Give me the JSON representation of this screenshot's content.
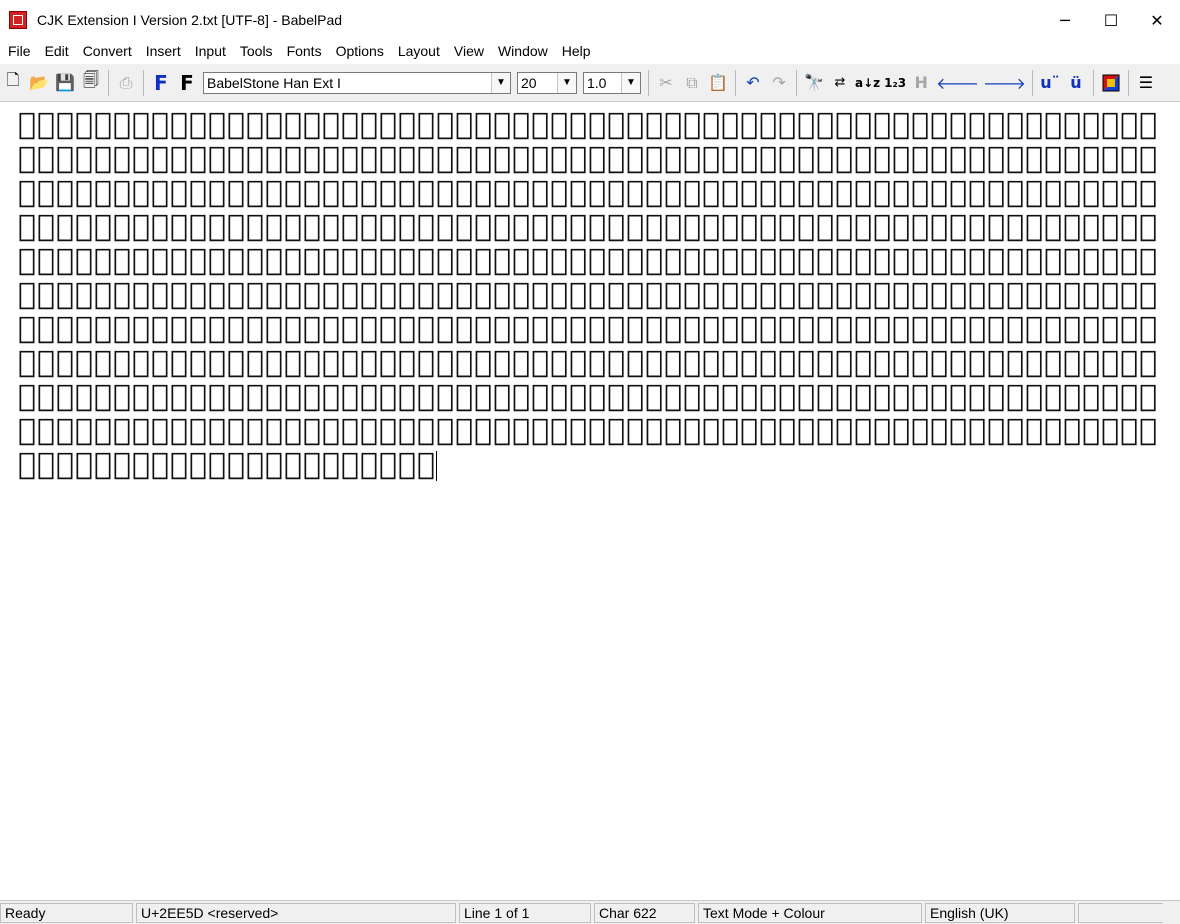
{
  "window": {
    "title": "CJK Extension I Version 2.txt [UTF-8] - BabelPad",
    "minimize": "─",
    "maximize": "☐",
    "close": "✕"
  },
  "menu": [
    "File",
    "Edit",
    "Convert",
    "Insert",
    "Input",
    "Tools",
    "Fonts",
    "Options",
    "Layout",
    "View",
    "Window",
    "Help"
  ],
  "toolbar": {
    "font_name": "BabelStone Han Ext I",
    "font_size": "20",
    "line_spacing": "1.0",
    "icons": [
      "new-document-icon",
      "open-folder-icon",
      "save-icon",
      "save-all-icon",
      "print-icon",
      "bold-f-icon",
      "font-f-icon",
      "cut-icon",
      "copy-icon",
      "paste-icon",
      "undo-icon",
      "redo-icon",
      "find-icon",
      "replace-icon",
      "sort-az-icon",
      "number-icon",
      "h-icon",
      "arrow-left-icon",
      "arrow-right-icon",
      "u-diaeresis-icon",
      "u-umlaut-icon",
      "color-icon",
      "align-icon"
    ]
  },
  "editor": {
    "text": "𲐀𲐁𲐂𲐃𲐄𲐅𲐆𲐇𲐈𲐉𲐊𲐋𲐌𲐍𲐎𲐏𲐐𲐑𲐒𲐓𲐔𲐕𲐖𲐗𲐘𲐙𲐚𲐛𲐜𲐝𲐞𲐟𲐠𲐡𲐢𲐣𲐤𲐥𲐦𲐧𲐨𲐩𲐪𲐫𲐬𲐭𲐮𲐯𲐰𲐱𲐲𲐳𲐴𲐵𲐶𲐷𲐸𲐹𲐺𲐻𲐼𲐽𲐾𲐿𲑀𲑁𲑂𲑃𲑄𲑅𲑆𲑇𲑈𲑉𲑊𲑋𲑌𲑍𲑎𲑏𲑐𲑑𲑒𲑓𲑔𲑕𲑖𲑗𲑘𲑙𲑚𲑛𲑜𲑝𲑞𲑟𲑠𲑡𲑢𲑣𲑤𲑥𲑦𲑧𲑨𲑩𲑪𲑫𲑬𲑭𲑮𲑯𲑰𲑱𲑲𲑳𲑴𲑵𲑶𲑷𲑸𲑹𲑺𲑻𲑼𲑽𲑾𲑿𲒀𲒁𲒂𲒃𲒄𲒅𲒆𲒇𲒈𲒉𲒊𲒋𲒌𲒍𲒎𲒏𲒐𲒑𲒒𲒓𲒔𲒕𲒖𲒗𲒘𲒙𲒚𲒛𲒜𲒝𲒞𲒟𲒠𲒡𲒢𲒣𲒤𲒥𲒦𲒧𲒨𲒩𲒪𲒫𲒬𲒭𲒮𲒯𲒰𲒱𲒲𲒳𲒴𲒵𲒶𲒷𲒸𲒹𲒺𲒻𲒼𲒽𲒾𲒿𲓀𲓁𲓂𲓃𲓄𲓅𲓆𲓇𲓈𲓉𲓊𲓋𲓌𲓍𲓎𲓏𲓐𲓑𲓒𲓓𲓔𲓕𲓖𲓗𲓘𲓙𲓚𲓛𲓜𲓝𲓞𲓟𲓠𲓡𲓢𲓣𲓤𲓥𲓦𲓧𲓨𲓩𲓪𲓫𲓬𲓭𲓮𲓯𲓰𲓱𲓲𲓳𲓴𲓵𲓶𲓷𲓸𲓹𲓺𲓻𲓼𲓽𲓾𲓿𲔀𲔁𲔂𲔃𲔄𲔅𲔆𲔇𲔈𲔉𲔊𲔋𲔌𲔍𲔎𲔏𲔐𲔑𲔒𲔓𲔔𲔕𲔖𲔗𲔘𲔙𲔚𲔛𲔜𲔝𲔞𲔟𲔠𲔡𲔢𲔣𲔤𲔥𲔦𲔧𲔨𲔩𲔪𲔫𲔬𲔭𲔮𲔯𲔰𲔱𲔲𲔳𲔴𲔵𲔶𲔷𲔸𲔹𲔺𲔻𲔼𲔽𲔾𲔿𲕀𲕁𲕂𲕃𲕄𲕅𲕆𲕇𲕈𲕉𲕊𲕋𲕌𲕍𲕎𲕏𲕐𲕑𲕒𲕓𲕔𲕕𲕖𲕗𲕘𲕙𲕚𲕛𲕜𲕝𲕞𲕟𲕠𲕡𲕢𲕣𲕤𲕥𲕦𲕧𲕨𲕩𲕪𲕫𲕬𲕭𲕮𲕯𲕰𲕱𲕲𲕳𲕴𲕵𲕶𲕷𲕸𲕹𲕺𲕻𲕼𲕽𲕾𲕿𲖀𲖁𲖂𲖃𲖄𲖅𲖆𲖇𲖈𲖉𲖊𲖋𲖌𲖍𲖎𲖏𲖐𲖑𲖒𲖓𲖔𲖕𲖖𲖗𲖘𲖙𲖚𲖛𲖜𲖝𲖞𲖟𲖠𲖡𲖢𲖣𲖤𲖥𲖦𲖧𲖨𲖩𲖪𲖫𲖬𲖭𲖮𲖯𲖰𲖱𲖲𲖳𲖴𲖵𲖶𲖷𲖸𲖹𲖺𲖻𲖼𲖽𲖾𲖿𲗀𲗁𲗂𲗃𲗄𲗅𲗆𲗇𲗈𲗉𲗊𲗋𲗌𲗍𲗎𲗏𲗐𲗑𲗒𲗓𲗔𲗕𲗖𲗗𲗘𲗙𲗚𲗛𲗜𲗝𲗞𲗟𲗠𲗡𲗢𲗣𲗤𲗥𲗦𲗧𲗨𲗩𲗪𲗫𲗬𲗭𲗮𲗯𲗰𲗱𲗲𲗳𲗴𲗵𲗶𲗷𲗸𲗹𲗺𲗻𲗼𲗽𲗾𲗿𲘀𲘁𲘂𲘃𲘄𲘅𲘆𲘇𲘈𲘉𲘊𲘋𲘌𲘍𲘎𲘏𲘐𲘑𲘒𲘓𲘔𲘕𲘖𲘗𲘘𲘙𲘚𲘛𲘜𲘝𲘞𲘟𲘠𲘡𲘢𲘣𲘤𲘥𲘦𲘧𲘨𲘩𲘪𲘫𲘬𲘭𲘮𲘯𲘰𲘱𲘲𲘳𲘴𲘵𲘶𲘷𲘸𲘹𲘺𲘻𲘼𲘽𲘾𲘿𲙀𲙁𲙂𲙃𲙄𲙅𲙆𲙇𲙈𲙉𲙊𲙋𲙌𲙍𲙎𲙏𲙐𲙑𲙒𲙓𲙔𲙕𲙖𲙗𲙘𲙙𲙚𲙛𲙜𲙝𲙞𲙟𲙠𲙡𲙢𲙣𲙤𲙥𲙦𲙧𲙨𲙩𲙪𲙫𲙬𲙭"
  },
  "status": {
    "state": "Ready",
    "codepoint": "U+2EE5D <reserved>",
    "line": "Line 1 of 1",
    "char": "Char 622",
    "mode": "Text Mode + Colour",
    "language": "English (UK)"
  },
  "colors": {
    "toolbar_bg": "#f0f0f0",
    "blue_f": "#1030c0",
    "app_icon": "#d32222"
  }
}
